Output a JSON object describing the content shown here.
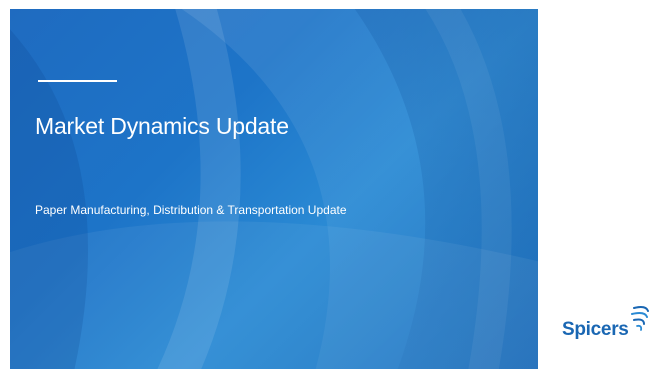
{
  "slide": {
    "title": "Market Dynamics Update",
    "subtitle": "Paper Manufacturing, Distribution & Transportation Update"
  },
  "logo": {
    "text": "Spicers",
    "icon": "spicers-swirl-icon",
    "color": "#1a67b3"
  },
  "colors": {
    "hero_base": "#1d74c8",
    "hero_light": "#2a8ad4",
    "text": "#ffffff"
  }
}
